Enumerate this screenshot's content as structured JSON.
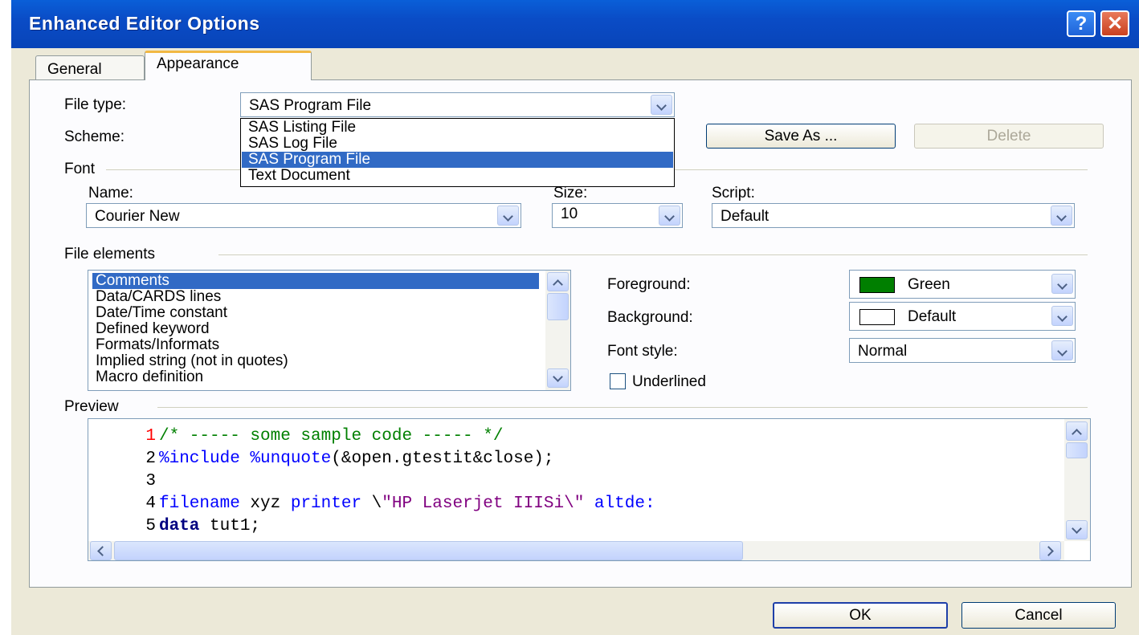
{
  "window": {
    "title": "Enhanced Editor Options"
  },
  "tabs": [
    {
      "label": "General",
      "active": false
    },
    {
      "label": "Appearance",
      "active": true
    }
  ],
  "file_type": {
    "label": "File type:",
    "value": "SAS Program File"
  },
  "file_type_options": [
    {
      "label": "SAS Listing File",
      "selected": false
    },
    {
      "label": "SAS Log File",
      "selected": false
    },
    {
      "label": "SAS Program File",
      "selected": true
    },
    {
      "label": "Text Document",
      "selected": false
    }
  ],
  "scheme": {
    "label": "Scheme:",
    "save_as": "Save As ...",
    "delete": "Delete"
  },
  "font": {
    "group_label": "Font",
    "name_label": "Name:",
    "name_value": "Courier New",
    "size_label": "Size:",
    "size_value": "10",
    "script_label": "Script:",
    "script_value": "Default"
  },
  "file_elements": {
    "group_label": "File elements",
    "items": [
      "Comments",
      "Data/CARDS lines",
      "Date/Time constant",
      "Defined keyword",
      "Formats/Informats",
      "Implied string (not in quotes)",
      "Macro definition"
    ],
    "selected": "Comments"
  },
  "colors": {
    "foreground_label": "Foreground:",
    "foreground_value": "Green",
    "foreground_swatch": "#007f00",
    "background_label": "Background:",
    "background_value": "Default",
    "background_swatch": "#ffffff",
    "font_style_label": "Font style:",
    "font_style_value": "Normal",
    "underlined_label": "Underlined",
    "underlined_checked": false
  },
  "preview": {
    "group_label": "Preview",
    "lines": [
      {
        "num": "1",
        "segments": [
          {
            "text": "/* ----- some sample code ----- */",
            "color": "#008000"
          }
        ]
      },
      {
        "num": "2",
        "segments": [
          {
            "text": "%include %unquote",
            "color": "#0000ff"
          },
          {
            "text": "(&open.gtestit&close);",
            "color": "#000000"
          }
        ]
      },
      {
        "num": "3",
        "segments": []
      },
      {
        "num": "4",
        "segments": [
          {
            "text": "filename",
            "color": "#0000ff"
          },
          {
            "text": " xyz ",
            "color": "#000000"
          },
          {
            "text": "printer",
            "color": "#0000ff"
          },
          {
            "text": " \\",
            "color": "#000000"
          },
          {
            "text": "\"HP Laserjet IIISi\\\"",
            "color": "#800080"
          },
          {
            "text": " altde:",
            "color": "#0000ff"
          }
        ]
      },
      {
        "num": "5",
        "segments": [
          {
            "text": "data",
            "color": "#000080",
            "bold": true
          },
          {
            "text": " tut1;",
            "color": "#000000"
          }
        ]
      }
    ],
    "first_line_num_color": "#ff0000"
  },
  "buttons": {
    "ok": "OK",
    "cancel": "Cancel"
  }
}
